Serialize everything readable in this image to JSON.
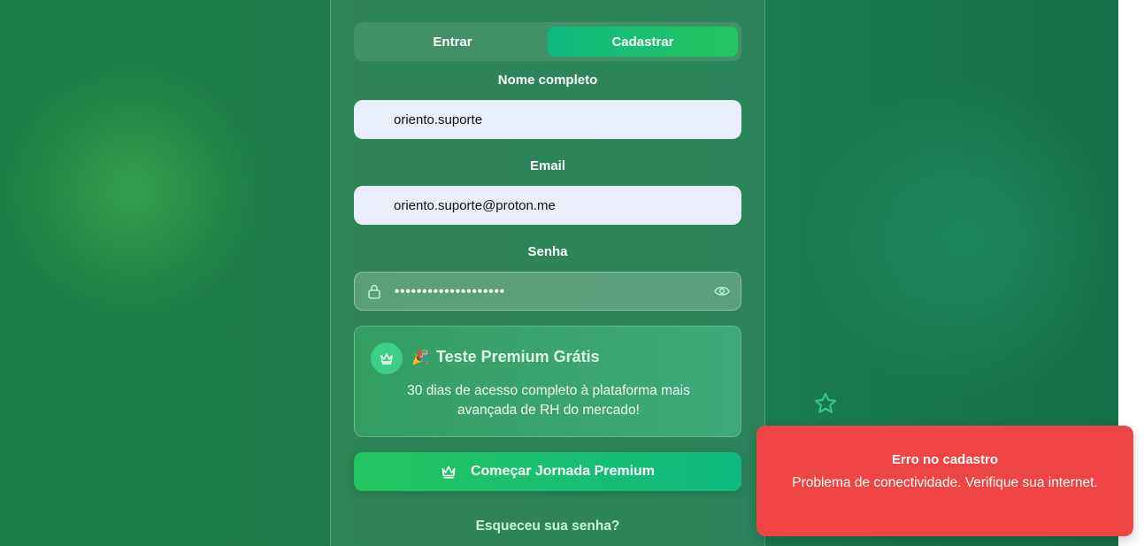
{
  "tabs": {
    "login_label": "Entrar",
    "signup_label": "Cadastrar",
    "active": "Cadastrar"
  },
  "form": {
    "name_label": "Nome completo",
    "name_value": "oriento.suporte",
    "email_label": "Email",
    "email_value": "oriento.suporte@proton.me",
    "password_label": "Senha",
    "password_mask": "••••••••••••••••••••"
  },
  "promo": {
    "emoji": "🎉",
    "title": "Teste Premium Grátis",
    "text": "30 dias de acesso completo à plataforma mais avançada de RH do mercado!"
  },
  "cta": {
    "label": "Começar Jornada Premium"
  },
  "forgot_label": "Esqueceu sua senha?",
  "toast": {
    "title": "Erro no cadastro",
    "message": "Problema de conectividade. Verifique sua internet."
  },
  "icons": [
    "lock-icon",
    "eye-icon",
    "crown-icon",
    "party-popper-icon",
    "star-icon"
  ],
  "colors": {
    "accent_green": "#22c55e",
    "accent_teal": "#10b981",
    "error_red": "#ef4444",
    "input_bg": "#e8eefc"
  }
}
